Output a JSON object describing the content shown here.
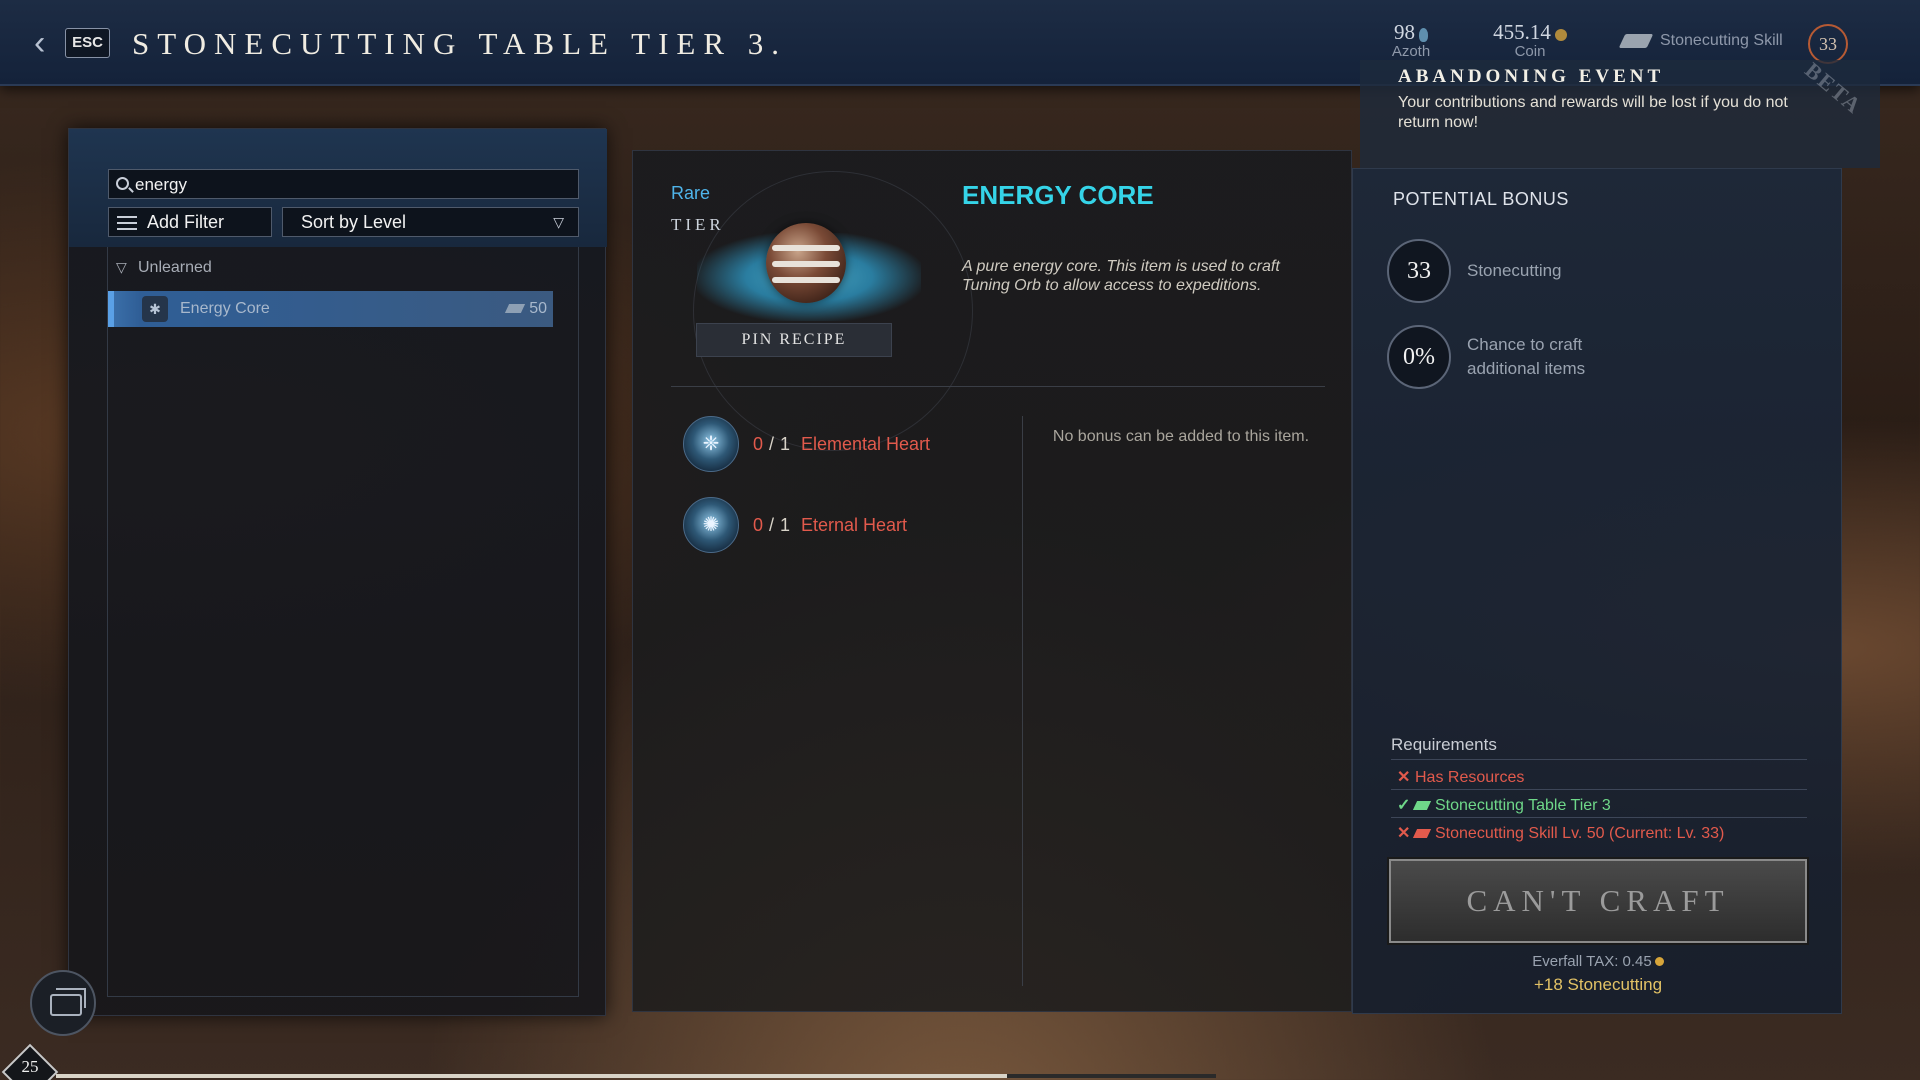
{
  "header": {
    "esc_label": "ESC",
    "title": "STONECUTTING TABLE TIER 3.",
    "azoth": {
      "value": "98",
      "label": "Azoth"
    },
    "coin": {
      "value": "455.14",
      "label": "Coin"
    },
    "skill": {
      "label": "Stonecutting Skill",
      "level": "33"
    }
  },
  "event": {
    "title": "ABANDONING EVENT",
    "text": "Your contributions and rewards will be lost if you do not return now!",
    "watermark": "BETA"
  },
  "left": {
    "search": {
      "value": "energy",
      "placeholder": ""
    },
    "add_filter_label": "Add Filter",
    "sort_label": "Sort by Level",
    "group_label": "Unlearned",
    "recipes": [
      {
        "name": "Energy Core",
        "level": "50"
      }
    ]
  },
  "item": {
    "rarity": "Rare",
    "tier_label": "TIER",
    "pin_label": "PIN RECIPE",
    "name": "ENERGY CORE",
    "description": "A pure energy core. This item is used to craft Tuning Orb to allow access to expeditions.",
    "ingredients": [
      {
        "have": "0",
        "need": "1",
        "name": "Elemental Heart"
      },
      {
        "have": "0",
        "need": "1",
        "name": "Eternal Heart"
      }
    ],
    "no_bonus_text": "No bonus can be added to this item."
  },
  "bonus": {
    "title": "POTENTIAL BONUS",
    "skill_value": "33",
    "skill_label": "Stonecutting",
    "chance_value": "0%",
    "chance_label": "Chance to craft additional items"
  },
  "requirements": {
    "title": "Requirements",
    "items": [
      {
        "status": "fail",
        "mark": "✕",
        "text": "Has Resources"
      },
      {
        "status": "ok",
        "mark": "✓",
        "text": "Stonecutting Table Tier 3"
      },
      {
        "status": "fail",
        "mark": "✕",
        "text": "Stonecutting Skill Lv. 50 (Current: Lv. 33)"
      }
    ]
  },
  "craft": {
    "button_label": "CAN'T CRAFT",
    "tax_text": "Everfall TAX: 0.45",
    "xp_text": "+18 Stonecutting"
  },
  "hud": {
    "player_level": "25",
    "xp_progress": 0.82
  },
  "colors": {
    "rare": "#4fb4ea",
    "item_name": "#35d4e8",
    "fail": "#e25a4c",
    "ok": "#6fd889"
  }
}
